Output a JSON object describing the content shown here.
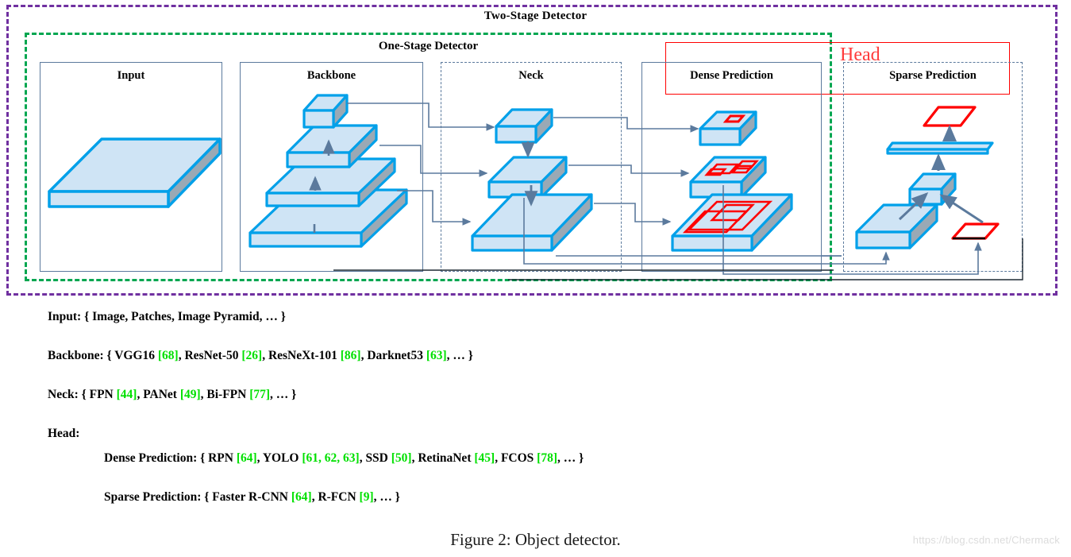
{
  "figure": {
    "caption": "Figure 2: Object detector.",
    "watermark": "https://blog.csdn.net/Chermack"
  },
  "diagram": {
    "outer_label": "Two-Stage Detector",
    "inner_label": "One-Stage Detector",
    "head_label": "Head",
    "colors": {
      "two_stage_border": "#7030a0",
      "one_stage_border": "#00a650",
      "head_border": "#ff0000",
      "head_text": "#ff3b3b",
      "panel_border": "#5b7a9d",
      "slab_outline": "#00a0e9",
      "slab_top": "#cfe4f5",
      "slab_side": "#9aa9b5",
      "connector": "#5b7a9d",
      "bbox_red": "#ff0000",
      "citation_green": "#00e000"
    },
    "panels": [
      {
        "id": "input",
        "title": "Input",
        "border_style": "solid"
      },
      {
        "id": "backbone",
        "title": "Backbone",
        "border_style": "solid"
      },
      {
        "id": "neck",
        "title": "Neck",
        "border_style": "dashed"
      },
      {
        "id": "dense",
        "title": "Dense Prediction",
        "border_style": "solid"
      },
      {
        "id": "sparse",
        "title": "Sparse Prediction",
        "border_style": "dashed"
      }
    ]
  },
  "legend": {
    "input": {
      "label": "Input: ",
      "items": "{ Image, Patches, Image Pyramid, … }"
    },
    "backbone": {
      "label": "Backbone: ",
      "parts": [
        {
          "t": "{ VGG16 "
        },
        {
          "c": "[68]"
        },
        {
          "t": ", ResNet-50 "
        },
        {
          "c": "[26]"
        },
        {
          "t": ", ResNeXt-101 "
        },
        {
          "c": "[86]"
        },
        {
          "t": ", Darknet53 "
        },
        {
          "c": "[63]"
        },
        {
          "t": ", … }"
        }
      ]
    },
    "neck": {
      "label": "Neck: ",
      "parts": [
        {
          "t": "{ FPN "
        },
        {
          "c": "[44]"
        },
        {
          "t": ", PANet "
        },
        {
          "c": "[49]"
        },
        {
          "t": ", Bi-FPN "
        },
        {
          "c": "[77]"
        },
        {
          "t": ", … }"
        }
      ]
    },
    "head": {
      "label": "Head:"
    },
    "dense": {
      "label": "Dense Prediction: ",
      "parts": [
        {
          "t": "{ RPN "
        },
        {
          "c": "[64]"
        },
        {
          "t": ", YOLO "
        },
        {
          "c": "[61, 62, 63]"
        },
        {
          "t": ", SSD "
        },
        {
          "c": "[50]"
        },
        {
          "t": ", RetinaNet "
        },
        {
          "c": "[45]"
        },
        {
          "t": ", FCOS "
        },
        {
          "c": "[78]"
        },
        {
          "t": ", … }"
        }
      ]
    },
    "sparse": {
      "label": "Sparse Prediction: ",
      "parts": [
        {
          "t": "{ Faster R-CNN "
        },
        {
          "c": "[64]"
        },
        {
          "t": ",  R-FCN "
        },
        {
          "c": "[9]"
        },
        {
          "t": ", … }"
        }
      ]
    }
  }
}
